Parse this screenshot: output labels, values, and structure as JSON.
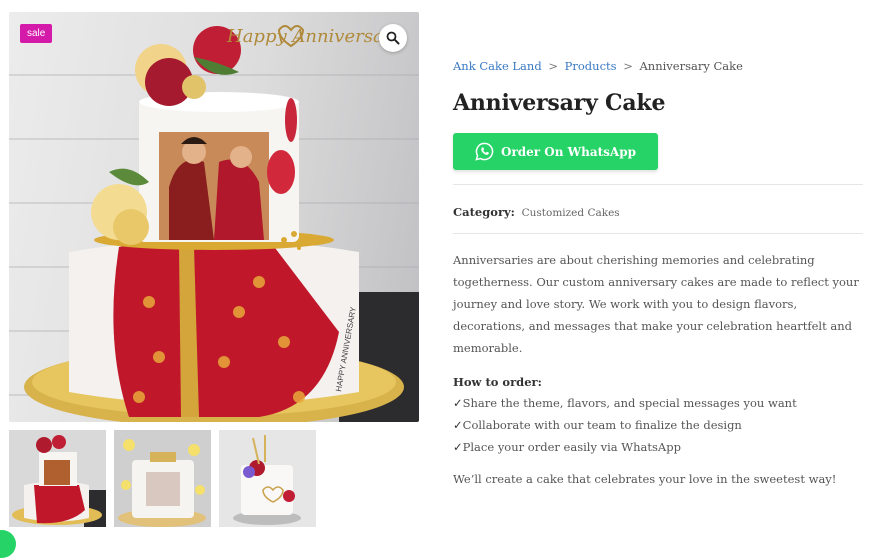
{
  "gallery": {
    "sale_label": "sale",
    "zoom_icon": "magnifier-icon",
    "cake_topper_text": "Happy Anniversary",
    "board_text": "HAPPY ANNIVERSARY",
    "thumbnails": [
      "thumb-1",
      "thumb-2",
      "thumb-3"
    ]
  },
  "breadcrumb": {
    "home": "Ank Cake Land",
    "sep1": ">",
    "products": "Products",
    "sep2": ">",
    "current": "Anniversary Cake"
  },
  "product": {
    "title": "Anniversary Cake",
    "whatsapp_label": "Order On WhatsApp",
    "category_label": "Category:",
    "category_value": "Customized Cakes",
    "description": "Anniversaries are about cherishing memories and celebrating togetherness. Our custom anniversary cakes are made to reflect your journey and love story. We work with you to design flavors, decorations, and messages that make your celebration heartfelt and memorable.",
    "howto_title": "How to order:",
    "steps": [
      "Share the theme, flavors, and special messages you want",
      "Collaborate with our team to finalize the design",
      "Place your order easily via WhatsApp"
    ],
    "closing": "We’ll create a cake that celebrates your love in the sweetest way!"
  },
  "colors": {
    "sale_badge": "#d41aa8",
    "whatsapp": "#25d366",
    "link": "#3a7ac2"
  }
}
